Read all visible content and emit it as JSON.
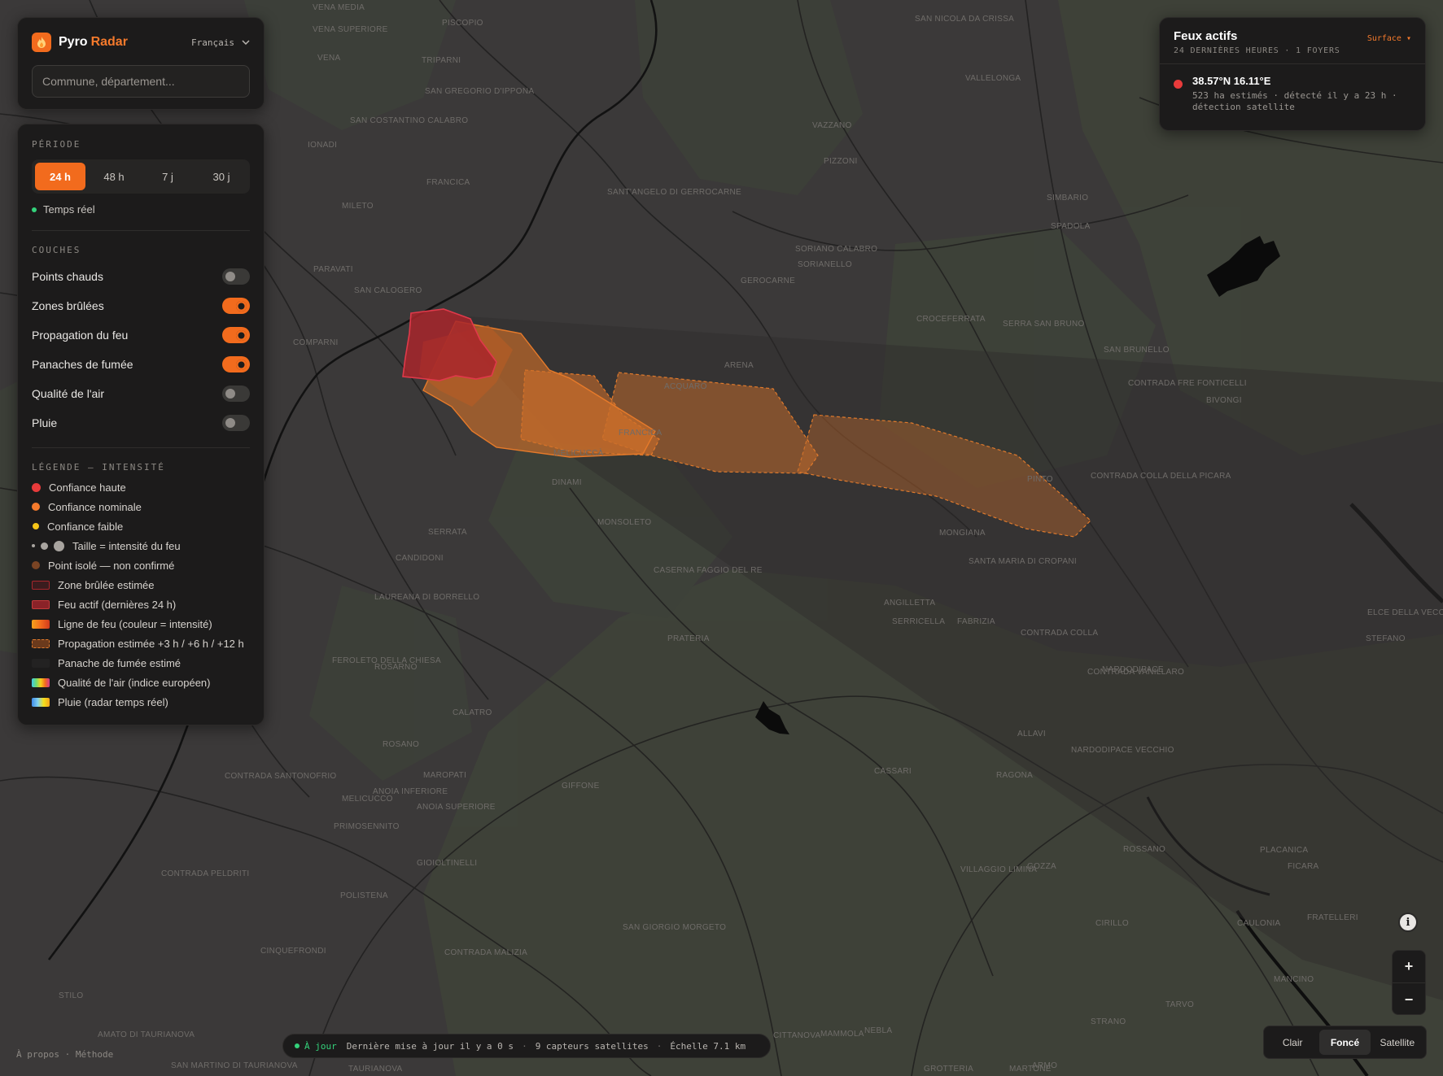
{
  "brand": {
    "name": "Pyro",
    "accent": "Radar",
    "language": "Français"
  },
  "search": {
    "placeholder": "Commune, département..."
  },
  "period": {
    "title": "PÉRIODE",
    "options": [
      "24 h",
      "48 h",
      "7 j",
      "30 j"
    ],
    "selected": "24 h",
    "realtime_label": "Temps réel"
  },
  "layers": {
    "title": "COUCHES",
    "items": [
      {
        "label": "Points chauds",
        "on": false
      },
      {
        "label": "Zones brûlées",
        "on": true
      },
      {
        "label": "Propagation du feu",
        "on": true
      },
      {
        "label": "Panaches de fumée",
        "on": true
      },
      {
        "label": "Qualité de l'air",
        "on": false
      },
      {
        "label": "Pluie",
        "on": false
      }
    ]
  },
  "legend": {
    "title": "LÉGENDE — INTENSITÉ",
    "items": [
      "Confiance haute",
      "Confiance nominale",
      "Confiance faible",
      "Taille = intensité du feu",
      "Point isolé — non confirmé",
      "Zone brûlée estimée",
      "Feu actif (dernières 24 h)",
      "Ligne de feu (couleur = intensité)",
      "Propagation estimée +3 h / +6 h / +12 h",
      "Panache de fumée estimé",
      "Qualité de l'air (indice européen)",
      "Pluie (radar temps réel)"
    ]
  },
  "fires": {
    "title": "Feux actifs",
    "subtitle": "24 DERNIÈRES HEURES · 1 FOYERS",
    "sort_label": "Surface ▾",
    "items": [
      {
        "coord": "38.57°N 16.11°E",
        "detail_1": "523 ha estimés · détecté il y a 23 h ·",
        "detail_2": "détection satellite"
      }
    ]
  },
  "status": {
    "ok": "À jour",
    "updated": "Dernière mise à jour il y a 0 s",
    "sensors": "9 capteurs satellites",
    "scale": "Échelle 7.1 km"
  },
  "basemap": {
    "options": [
      "Clair",
      "Foncé",
      "Satellite"
    ],
    "selected": "Foncé"
  },
  "zoom": {
    "in": "+",
    "out": "−"
  },
  "info": "i",
  "footer": {
    "about": "À propos",
    "method": "Méthode"
  },
  "map": {
    "places": [
      "VENA MEDIA",
      "VENA SUPERIORE",
      "PISCOPIO",
      "SAN NICOLA DA CRISSA",
      "VENA",
      "TRIPARNI",
      "SAN GREGORIO D'IPPONA",
      "VALLELONGA",
      "SAN COSTANTINO CALABRO",
      "IONADI",
      "VAZZANO",
      "PIZZONI",
      "FRANCICA",
      "MILETO",
      "SANT'ANGELO DI GERROCARNE",
      "SIMBARIO",
      "SPADOLA",
      "PARAVATI",
      "SAN CALOGERO",
      "SORIANO CALABRO",
      "SORIANELLO",
      "GEROCARNE",
      "CROCEFERRATA",
      "SERRA SAN BRUNO",
      "COMPARNI",
      "ARENA",
      "SAN BRUNELLO",
      "ACQUARO",
      "CONTRADA FRE FONTICELLI",
      "FRANCICA",
      "MELICUCCÀ",
      "DINAMI",
      "PINTO",
      "MONSOLETO",
      "CONTRADA COLLA DELLA PICARA",
      "SERRATA",
      "MONGIANA",
      "SANTA MARIA DI CROPANI",
      "CANDIDONI",
      "CASERNA FAGGIO DEL RE",
      "LAUREANA DI BORRELLO",
      "ANGILLETTA",
      "SERRICELLA",
      "FABRIZIA",
      "CONTRADA COLLA",
      "FEROLETO DELLA CHIESA",
      "PRATERIA",
      "ROSARNO",
      "CONTRADA VANILLARO",
      "NARDODIPACE",
      "CALATRO",
      "ROSANO",
      "ALLAVI",
      "NARDODIPACE VECCHIO",
      "MAROPATI",
      "GIFFONE",
      "CASSARI",
      "RAGONA",
      "CONTRADA SANTONOFRIO",
      "ANOIA INFERIORE",
      "ANOIA SUPERIORE",
      "MELICUCCO",
      "PRIMOSENNITO",
      "GIOIOLTINELLI",
      "POLISTENA",
      "ROSSANO",
      "CONTRADA PELDRITI",
      "CINQUEFRONDI",
      "CONTRADA MALIZIA",
      "SAN GIORGIO MORGETO",
      "VILLAGGIO LIMINA",
      "GOZZA",
      "FICARA",
      "STILO",
      "AMATO DI TAURIANOVA",
      "SAN MARTINO DI TAURIANOVA",
      "TAURIANOVA",
      "CITTANOVA",
      "MAMMOLA",
      "NEBLA",
      "GROTTERIA",
      "MARTONE",
      "ARMO",
      "TARVO",
      "STRANO",
      "MANCINO",
      "CAULONIA",
      "CIRILLO",
      "FRATELLERI",
      "PLACANICA",
      "STEFANO",
      "BIVONGI",
      "ELCE DELLA VECCHIA",
      "GROSSA CAMBIA"
    ]
  }
}
